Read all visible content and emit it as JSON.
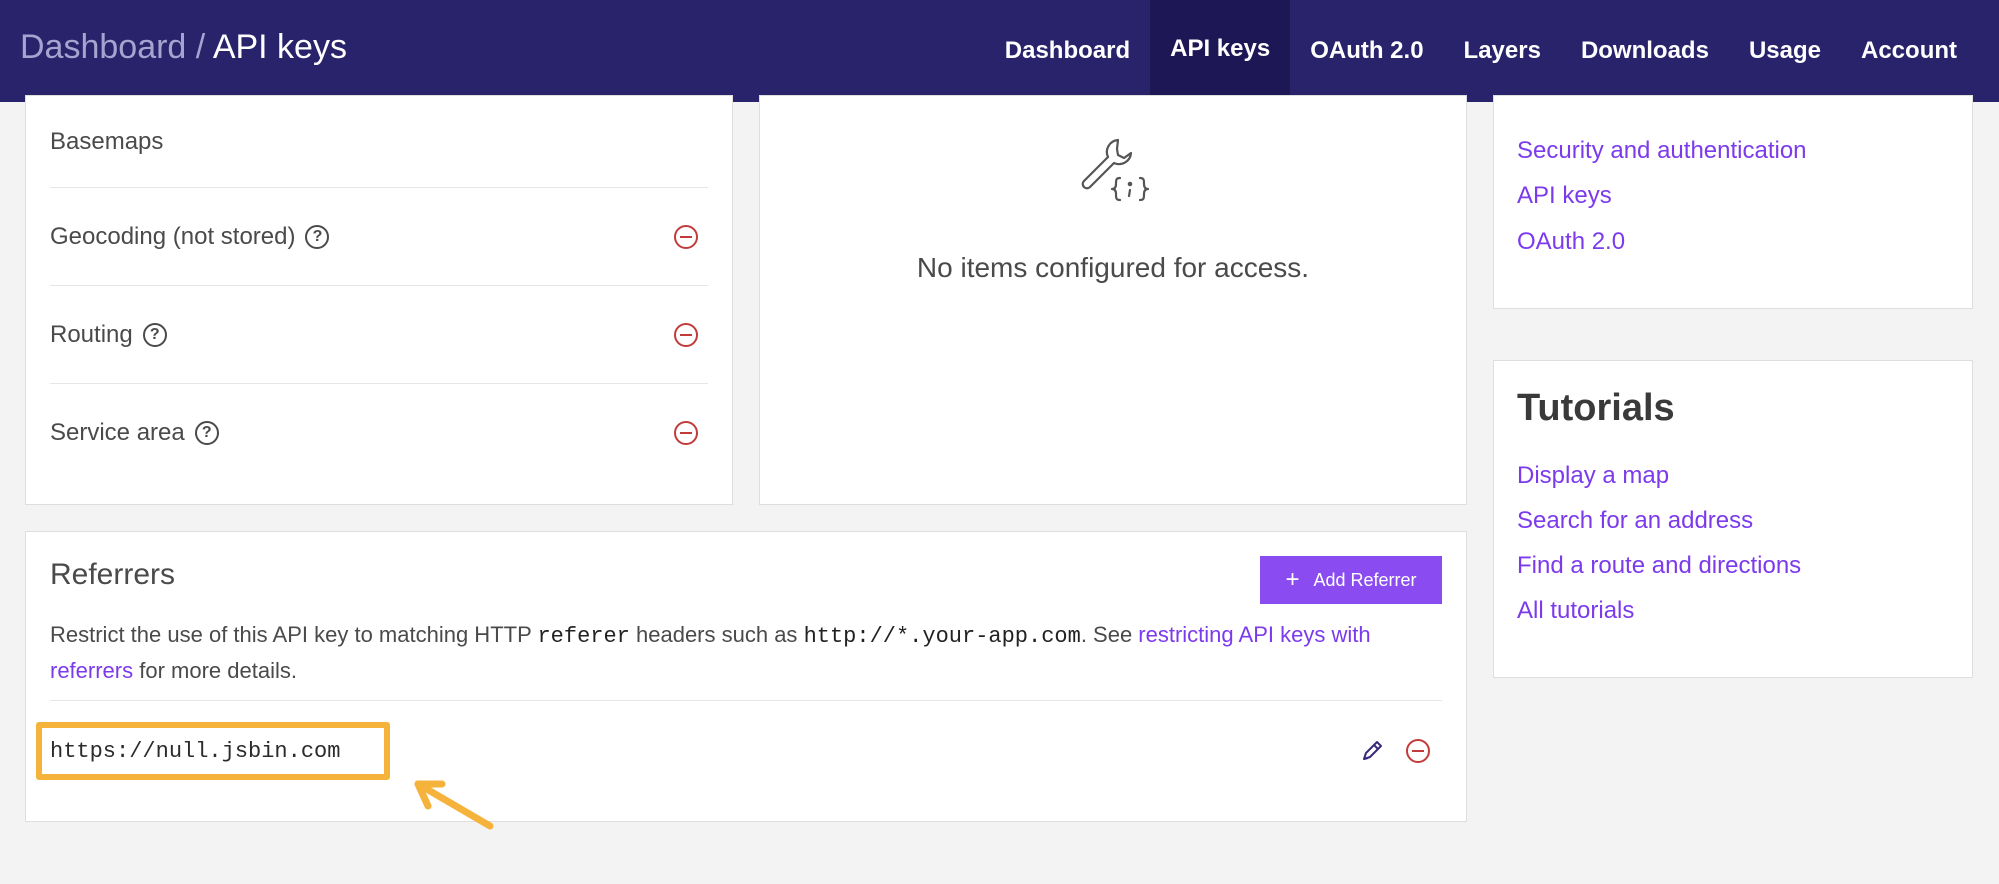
{
  "header": {
    "breadcrumb_parent": "Dashboard",
    "breadcrumb_sep": " / ",
    "breadcrumb_current": "API keys",
    "nav": [
      "Dashboard",
      "API keys",
      "OAuth 2.0",
      "Layers",
      "Downloads",
      "Usage",
      "Account"
    ],
    "active_nav": "API keys"
  },
  "services": {
    "items": [
      {
        "label": "Basemaps",
        "help": false,
        "removable": false
      },
      {
        "label": "Geocoding (not stored)",
        "help": true,
        "removable": true
      },
      {
        "label": "Routing",
        "help": true,
        "removable": true
      },
      {
        "label": "Service area",
        "help": true,
        "removable": true
      }
    ],
    "help_glyph": "?"
  },
  "access": {
    "icon": "wrench-code-icon",
    "empty_message": "No items configured for access."
  },
  "docs_links": [
    "Security and authentication",
    "API keys",
    "OAuth 2.0"
  ],
  "tutorials": {
    "title": "Tutorials",
    "links": [
      "Display a map",
      "Search for an address",
      "Find a route and directions",
      "All tutorials"
    ]
  },
  "referrers": {
    "title": "Referrers",
    "add_button": "Add Referrer",
    "desc_part1": "Restrict the use of this API key to matching HTTP ",
    "desc_code1": "referer",
    "desc_part2": " headers such as ",
    "desc_code2": "http://*.your-app.com",
    "desc_part3": ". See ",
    "desc_link": "restricting API keys with referrers",
    "desc_part4": " for more details.",
    "items": [
      "https://null.jsbin.com"
    ]
  },
  "colors": {
    "header_bg": "#29236b",
    "accent": "#8a4cf0",
    "link": "#7c3aed",
    "remove": "#c23b3b",
    "highlight": "#f6b33c"
  }
}
